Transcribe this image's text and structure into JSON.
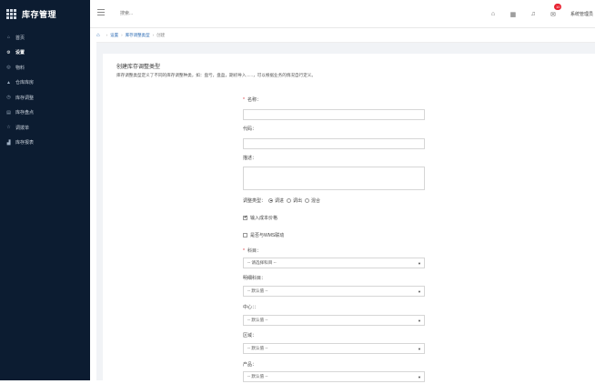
{
  "sidebar": {
    "brand": "库存管理",
    "items": [
      {
        "icon": "home-icon",
        "glyph": "⌂",
        "label": "首页"
      },
      {
        "icon": "settings-icon",
        "glyph": "⚙",
        "label": "设置"
      },
      {
        "icon": "material-icon",
        "glyph": "◎",
        "label": "物料"
      },
      {
        "icon": "warehouse-icon",
        "glyph": "▲",
        "label": "仓库库房"
      },
      {
        "icon": "adjust-icon",
        "glyph": "◷",
        "label": "库存调整"
      },
      {
        "icon": "count-icon",
        "glyph": "▤",
        "label": "库存盘点"
      },
      {
        "icon": "transfer-icon",
        "glyph": "☆",
        "label": "调拨单"
      },
      {
        "icon": "report-icon",
        "glyph": "▟",
        "label": "库存报表"
      }
    ]
  },
  "topbar": {
    "search_placeholder": "搜索...",
    "notification_count": "10",
    "user": "系统管理员"
  },
  "breadcrumb": {
    "items": [
      "设置",
      "库存调整类型"
    ],
    "current": "创建"
  },
  "panel": {
    "title": "创建库存调整类型",
    "description": "库存调整类型定义了不同的库存调整种类，如：盘亏，盘盈，期初导入......，可以根据业务的情况自行定义。"
  },
  "form": {
    "name_label": "名称：",
    "name_value": "",
    "code_label": "代码：",
    "code_value": "",
    "desc_label": "描述：",
    "desc_value": "",
    "adjust_type_label": "调整类型：",
    "adjust_options": [
      "调进",
      "调出",
      "混合"
    ],
    "adjust_selected": "调进",
    "cost_price_label": "输入成本价格",
    "cost_price_checked": true,
    "wms_label": "是否与WMS联动",
    "wms_checked": false,
    "subject_label": "科目：",
    "subject_value": "-- 请选择科目 --",
    "detail_subject_label": "明细科目：",
    "detail_subject_value": "-- 默认值 --",
    "center_label": "中心：：",
    "center_value": "-- 默认值 --",
    "region_label": "区域：",
    "region_value": "-- 默认值 --",
    "product_label": "产品：",
    "product_value": "-- 默认值 --"
  }
}
